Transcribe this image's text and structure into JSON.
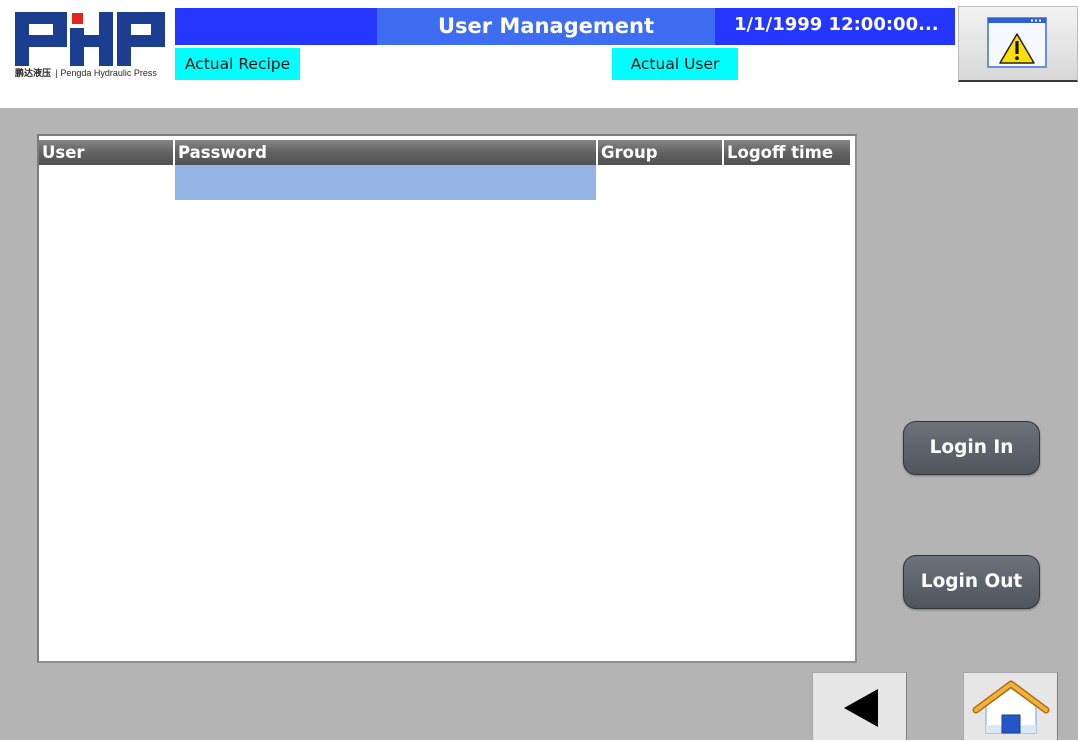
{
  "header": {
    "logo": {
      "text": "PHP",
      "caption_cn": "鹏达液压",
      "caption_en": "| Pengda Hydraulic Press"
    },
    "title": "User Management",
    "datetime": "1/1/1999 12:00:00...",
    "actual_recipe": "Actual Recipe",
    "actual_user": "Actual User",
    "alarm_icon": "warning-window-icon"
  },
  "user_table": {
    "columns": [
      "User",
      "Password",
      "Group",
      "Logoff time"
    ],
    "rows": [
      [
        "",
        "",
        "",
        ""
      ]
    ],
    "selected_cell": {
      "row": 0,
      "column": 1
    }
  },
  "side_buttons": {
    "login_in": "Login In",
    "login_out": "Login Out"
  },
  "navigation": {
    "back_icon": "back-arrow-icon",
    "home_icon": "home-icon"
  },
  "colors": {
    "title_bar": "#2537ff",
    "title_segment": "#3e6df2",
    "status_box": "#00ffff",
    "body_background": "#b4b4b4",
    "selected_cell": "#94b4e6",
    "action_button": "#5c6169",
    "nav_button": "#e6e6e6",
    "logo_blue": "#1b3e91",
    "logo_red": "#e52421"
  }
}
